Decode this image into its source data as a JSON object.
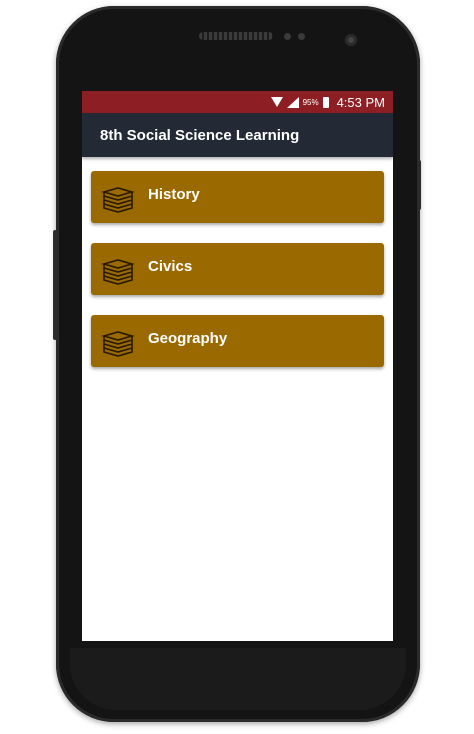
{
  "status_bar": {
    "battery": "95%",
    "time": "4:53 PM",
    "color": "#8d1e23"
  },
  "app_bar": {
    "title": "8th Social Science Learning",
    "color": "#232a36"
  },
  "menu": {
    "item_color": "#9a6a00",
    "items": [
      {
        "label": "History",
        "icon": "books-icon"
      },
      {
        "label": "Civics",
        "icon": "books-icon"
      },
      {
        "label": "Geography",
        "icon": "books-icon"
      }
    ]
  }
}
